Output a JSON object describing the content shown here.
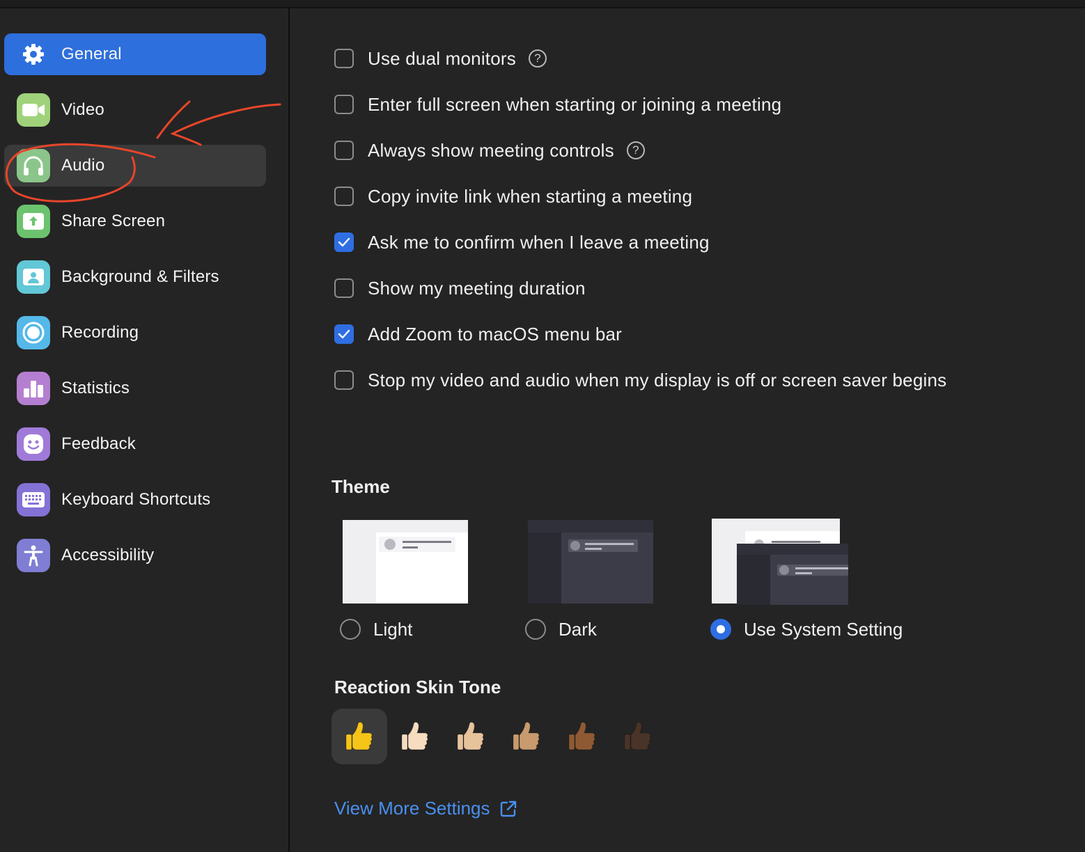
{
  "sidebar": {
    "items": [
      {
        "label": "General",
        "icon": "gear-icon",
        "color": "#2d6fdc"
      },
      {
        "label": "Video",
        "icon": "video-camera-icon",
        "color": "#9fd27a"
      },
      {
        "label": "Audio",
        "icon": "headphones-icon",
        "color": "#8bc58a"
      },
      {
        "label": "Share Screen",
        "icon": "share-screen-icon",
        "color": "#6cc36e"
      },
      {
        "label": "Background & Filters",
        "icon": "person-portrait-icon",
        "color": "#62c7d6"
      },
      {
        "label": "Recording",
        "icon": "record-icon",
        "color": "#55b8e8"
      },
      {
        "label": "Statistics",
        "icon": "bar-chart-icon",
        "color": "#b57fd1"
      },
      {
        "label": "Feedback",
        "icon": "smiley-icon",
        "color": "#a07ad8"
      },
      {
        "label": "Keyboard Shortcuts",
        "icon": "keyboard-icon",
        "color": "#8572d6"
      },
      {
        "label": "Accessibility",
        "icon": "accessibility-icon",
        "color": "#7f7ed4"
      }
    ]
  },
  "general": {
    "options": [
      {
        "label": "Use dual monitors",
        "checked": false,
        "help": true
      },
      {
        "label": "Enter full screen when starting or joining a meeting",
        "checked": false,
        "help": false
      },
      {
        "label": "Always show meeting controls",
        "checked": false,
        "help": true
      },
      {
        "label": "Copy invite link when starting a meeting",
        "checked": false,
        "help": false
      },
      {
        "label": "Ask me to confirm when I leave a meeting",
        "checked": true,
        "help": false
      },
      {
        "label": "Show my meeting duration",
        "checked": false,
        "help": false
      },
      {
        "label": "Add Zoom to macOS menu bar",
        "checked": true,
        "help": false
      },
      {
        "label": "Stop my video and audio when my display is off or screen saver begins",
        "checked": false,
        "help": false
      }
    ],
    "theme": {
      "title": "Theme",
      "choices": [
        {
          "label": "Light",
          "selected": false
        },
        {
          "label": "Dark",
          "selected": false
        },
        {
          "label": "Use System Setting",
          "selected": true
        }
      ]
    },
    "skin_tone": {
      "title": "Reaction Skin Tone",
      "tones": [
        "#f5c518",
        "#f7dcc0",
        "#e7c39c",
        "#c89a6e",
        "#8e5a33",
        "#4a3328"
      ],
      "selected_index": 0
    },
    "view_more": "View More Settings"
  },
  "colors": {
    "accent": "#2d6fdc",
    "link": "#4a8ff0",
    "background": "#242424"
  }
}
